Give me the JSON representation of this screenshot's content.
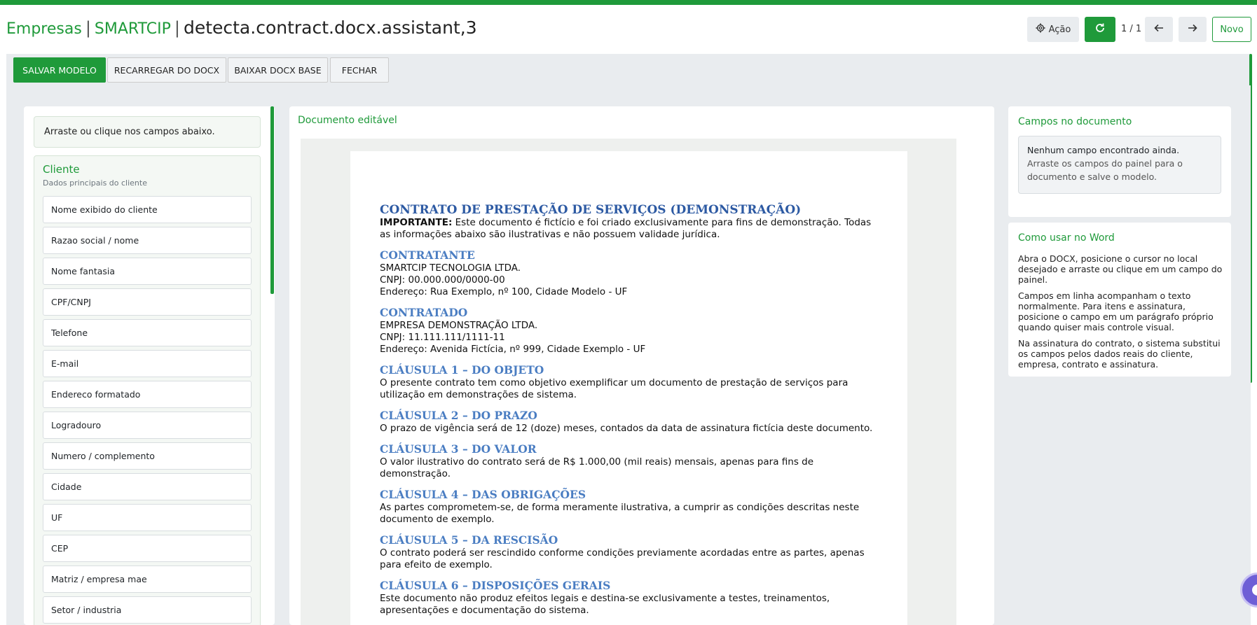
{
  "header": {
    "breadcrumb": [
      "Empresas",
      "SMARTCIP"
    ],
    "title": "detecta.contract.docx.assistant,3",
    "action_label": "Ação",
    "pager": "1 / 1",
    "new_label": "Novo"
  },
  "toolbar": {
    "save": "SALVAR MODELO",
    "reload": "RECARREGAR DO DOCX",
    "download": "BAIXAR DOCX BASE",
    "close": "FECHAR"
  },
  "left_panel": {
    "hint": "Arraste ou clique nos campos abaixo.",
    "group_title": "Cliente",
    "group_subtitle": "Dados principais do cliente",
    "fields": [
      "Nome exibido do cliente",
      "Razao social / nome",
      "Nome fantasia",
      "CPF/CNPJ",
      "Telefone",
      "E-mail",
      "Endereco formatado",
      "Logradouro",
      "Numero / complemento",
      "Cidade",
      "UF",
      "CEP",
      "Matriz / empresa mae",
      "Setor / industria"
    ]
  },
  "center_panel": {
    "title": "Documento editável",
    "document": {
      "heading": "CONTRATO DE PRESTAÇÃO DE SERVIÇOS (DEMONSTRAÇÃO)",
      "important_label": "IMPORTANTE:",
      "important_text": " Este documento é fictício e foi criado exclusivamente para fins de demonstração. Todas as informações abaixo são ilustrativas e não possuem validade jurídica.",
      "contratante_title": "CONTRATANTE",
      "contratante_lines": [
        "SMARTCIP TECNOLOGIA LTDA.",
        "CNPJ: 00.000.000/0000-00",
        "Endereço: Rua Exemplo, nº 100, Cidade Modelo - UF"
      ],
      "contratado_title": "CONTRATADO",
      "contratado_lines": [
        "EMPRESA DEMONSTRAÇÃO LTDA.",
        "CNPJ: 11.111.111/1111-11",
        "Endereço: Avenida Fictícia, nº 999, Cidade Exemplo - UF"
      ],
      "clauses": [
        {
          "title": "CLÁUSULA 1 – DO OBJETO",
          "text": "O presente contrato tem como objetivo exemplificar um documento de prestação de serviços para utilização em demonstrações de sistema."
        },
        {
          "title": "CLÁUSULA 2 – DO PRAZO",
          "text": "O prazo de vigência será de 12 (doze) meses, contados da data de assinatura fictícia deste documento."
        },
        {
          "title": "CLÁUSULA 3 – DO VALOR",
          "text": "O valor ilustrativo do contrato será de R$ 1.000,00 (mil reais) mensais, apenas para fins de demonstração."
        },
        {
          "title": "CLÁUSULA 4 – DAS OBRIGAÇÕES",
          "text": "As partes comprometem-se, de forma meramente ilustrativa, a cumprir as condições descritas neste documento de exemplo."
        },
        {
          "title": "CLÁUSULA 5 – DA RESCISÃO",
          "text": "O contrato poderá ser rescindido conforme condições previamente acordadas entre as partes, apenas para efeito de exemplo."
        },
        {
          "title": "CLÁUSULA 6 – DISPOSIÇÕES GERAIS",
          "text": "Este documento não produz efeitos legais e destina-se exclusivamente a testes, treinamentos, apresentações e documentação do sistema."
        }
      ]
    }
  },
  "right_panel": {
    "fields_title": "Campos no documento",
    "empty_title": "Nenhum campo encontrado ainda.",
    "empty_text": "Arraste os campos do painel para o documento e salve o modelo.",
    "usage_title": "Como usar no Word",
    "usage_paragraphs": [
      "Abra o DOCX, posicione o cursor no local desejado e arraste ou clique em um campo do painel.",
      "Campos em linha acompanham o texto normalmente. Para itens e assinatura, posicione o campo em um parágrafo próprio quando quiser mais controle visual.",
      "Na assinatura do contrato, o sistema substitui os campos pelos dados reais do cliente, empresa, contrato e assinatura."
    ]
  },
  "colors": {
    "brand": "#1f9a3a",
    "heading_blue": "#2d5aa3",
    "clause_blue": "#4a7dc2"
  },
  "icons": [
    "gear-icon",
    "refresh-icon",
    "arrow-left-icon",
    "arrow-right-icon",
    "chat-icon"
  ]
}
